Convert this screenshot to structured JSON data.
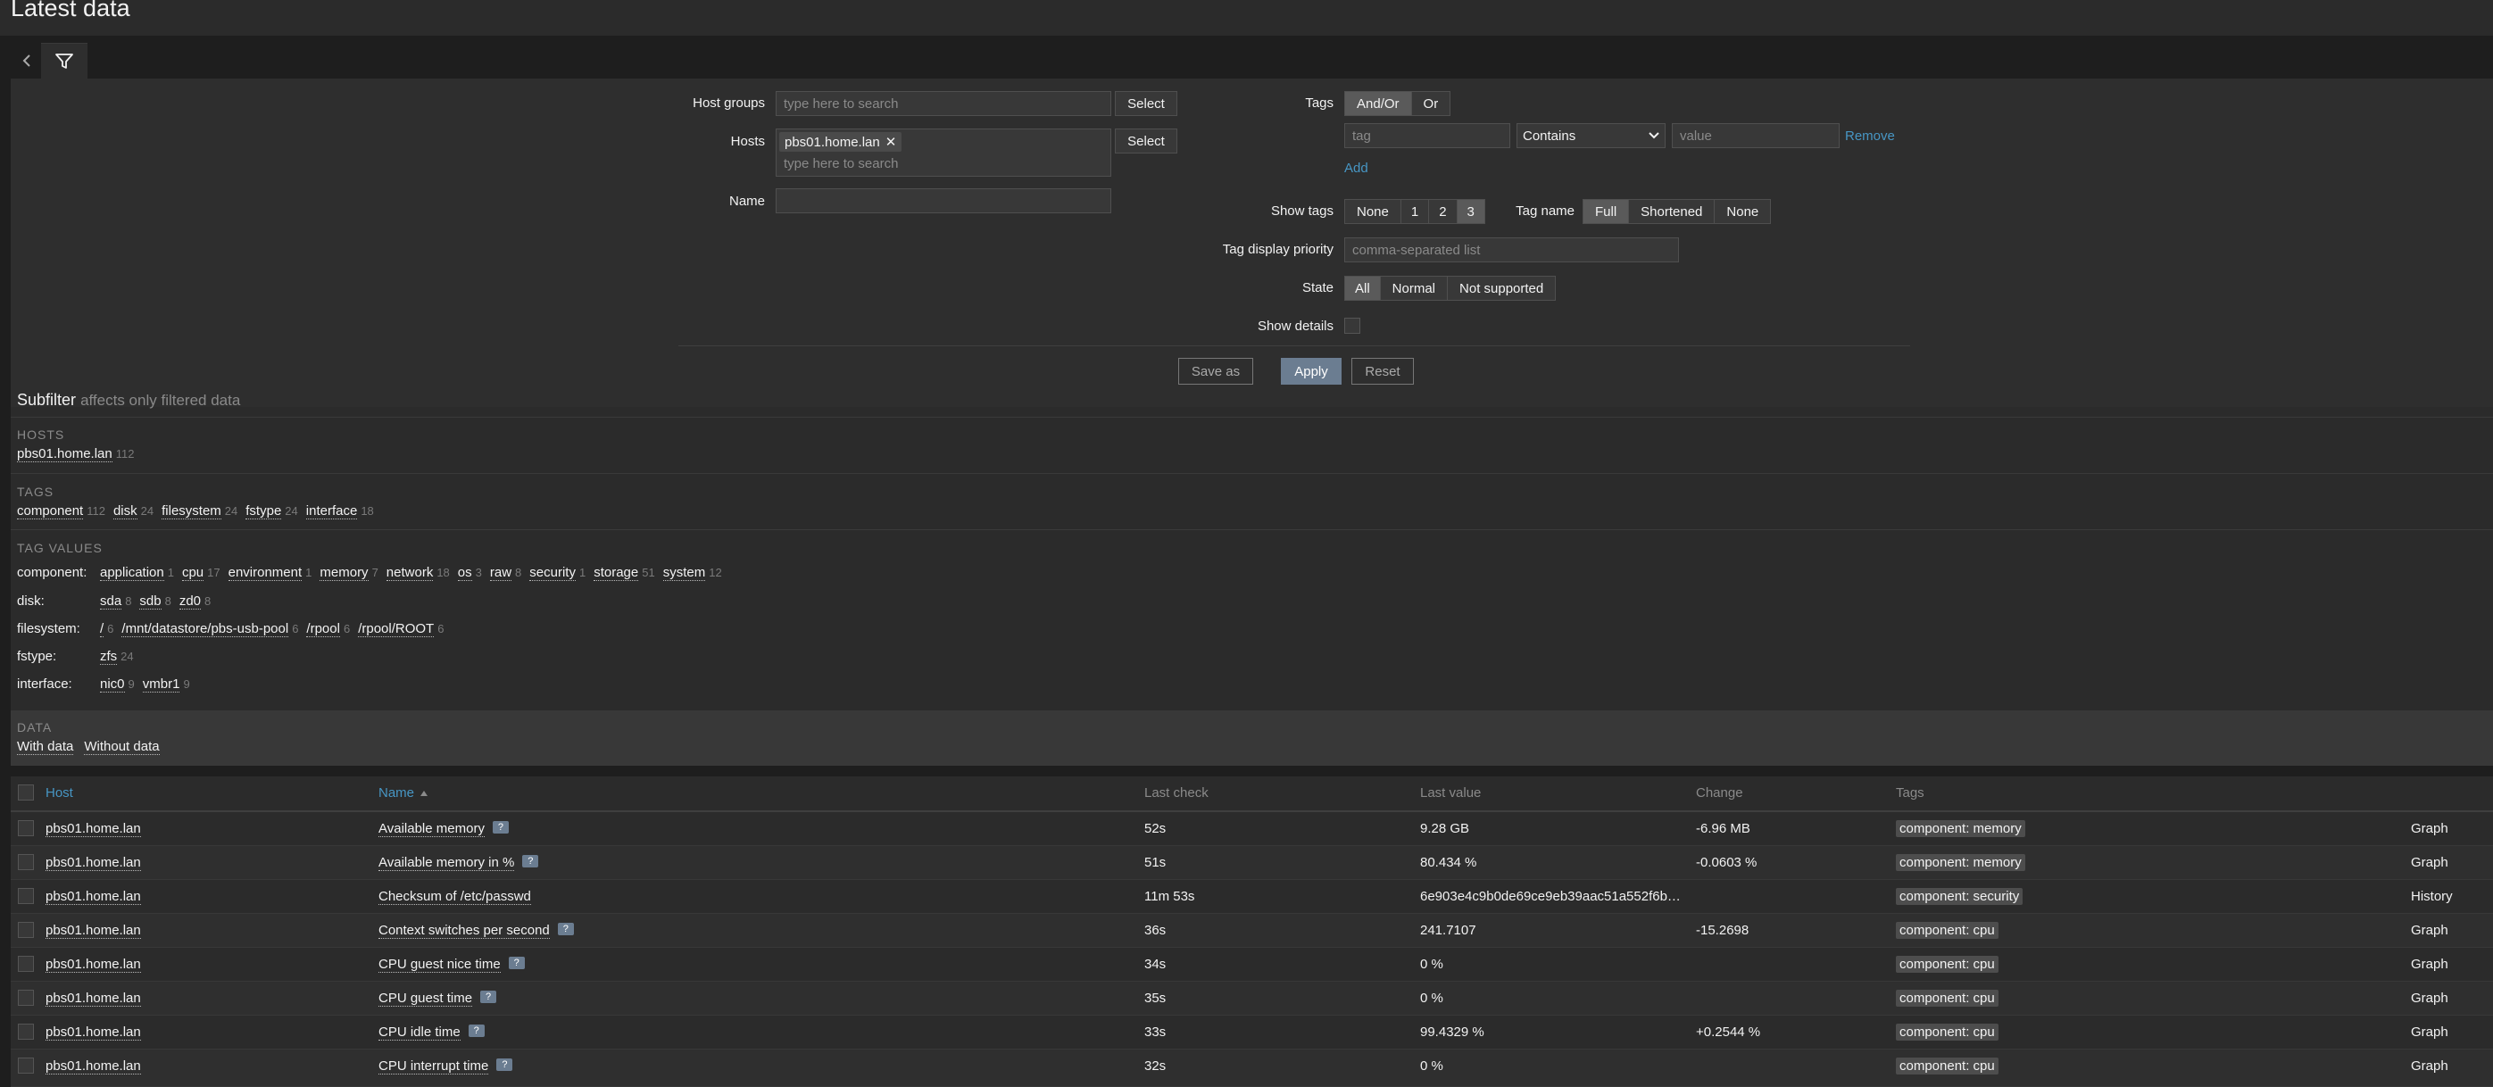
{
  "page_title": "Latest data",
  "icons": {
    "back": "chevron-left-icon",
    "filter": "filter-icon",
    "help": "help-icon",
    "remove": "close-icon",
    "sort": "sort-asc-icon"
  },
  "filter": {
    "host_groups_label": "Host groups",
    "host_groups_placeholder": "type here to search",
    "select_label": "Select",
    "hosts_label": "Hosts",
    "hosts_chip": "pbs01.home.lan",
    "hosts_placeholder": "type here to search",
    "name_label": "Name",
    "name_value": "",
    "tags_label": "Tags",
    "tags_mode": [
      "And/Or",
      "Or"
    ],
    "tag_placeholder": "tag",
    "tag_operator": "Contains",
    "value_placeholder": "value",
    "remove_label": "Remove",
    "add_label": "Add",
    "show_tags_label": "Show tags",
    "show_tags_options": [
      "None",
      "1",
      "2",
      "3"
    ],
    "tag_name_label": "Tag name",
    "tag_name_options": [
      "Full",
      "Shortened",
      "None"
    ],
    "tag_priority_label": "Tag display priority",
    "tag_priority_placeholder": "comma-separated list",
    "state_label": "State",
    "state_options": [
      "All",
      "Normal",
      "Not supported"
    ],
    "show_details_label": "Show details",
    "save_as_label": "Save as",
    "apply_label": "Apply",
    "reset_label": "Reset"
  },
  "subfilter": {
    "title": "Subfilter",
    "subtitle": "affects only filtered data",
    "hosts_heading": "HOSTS",
    "hosts": [
      {
        "name": "pbs01.home.lan",
        "count": "112"
      }
    ],
    "tags_heading": "TAGS",
    "tags": [
      {
        "name": "component",
        "count": "112"
      },
      {
        "name": "disk",
        "count": "24"
      },
      {
        "name": "filesystem",
        "count": "24"
      },
      {
        "name": "fstype",
        "count": "24"
      },
      {
        "name": "interface",
        "count": "18"
      }
    ],
    "tag_values_heading": "TAG VALUES",
    "tag_values": [
      {
        "label": "component:",
        "items": [
          {
            "name": "application",
            "count": "1"
          },
          {
            "name": "cpu",
            "count": "17"
          },
          {
            "name": "environment",
            "count": "1"
          },
          {
            "name": "memory",
            "count": "7"
          },
          {
            "name": "network",
            "count": "18"
          },
          {
            "name": "os",
            "count": "3"
          },
          {
            "name": "raw",
            "count": "8"
          },
          {
            "name": "security",
            "count": "1"
          },
          {
            "name": "storage",
            "count": "51"
          },
          {
            "name": "system",
            "count": "12"
          }
        ]
      },
      {
        "label": "disk:",
        "items": [
          {
            "name": "sda",
            "count": "8"
          },
          {
            "name": "sdb",
            "count": "8"
          },
          {
            "name": "zd0",
            "count": "8"
          }
        ]
      },
      {
        "label": "filesystem:",
        "items": [
          {
            "name": "/",
            "count": "6"
          },
          {
            "name": "/mnt/datastore/pbs-usb-pool",
            "count": "6"
          },
          {
            "name": "/rpool",
            "count": "6"
          },
          {
            "name": "/rpool/ROOT",
            "count": "6"
          }
        ]
      },
      {
        "label": "fstype:",
        "items": [
          {
            "name": "zfs",
            "count": "24"
          }
        ]
      },
      {
        "label": "interface:",
        "items": [
          {
            "name": "nic0",
            "count": "9"
          },
          {
            "name": "vmbr1",
            "count": "9"
          }
        ]
      }
    ],
    "data_heading": "DATA",
    "data_options": [
      "With data",
      "Without data"
    ]
  },
  "table": {
    "columns": [
      "Host",
      "Name",
      "Last check",
      "Last value",
      "Change",
      "Tags"
    ],
    "rows": [
      {
        "host": "pbs01.home.lan",
        "name": "Available memory",
        "help": true,
        "last_check": "52s",
        "last_value": "9.28 GB",
        "change": "-6.96 MB",
        "tag": "component: memory",
        "action": "Graph"
      },
      {
        "host": "pbs01.home.lan",
        "name": "Available memory in %",
        "help": true,
        "last_check": "51s",
        "last_value": "80.434 %",
        "change": "-0.0603 %",
        "tag": "component: memory",
        "action": "Graph"
      },
      {
        "host": "pbs01.home.lan",
        "name": "Checksum of /etc/passwd",
        "help": false,
        "last_check": "11m 53s",
        "last_value": "6e903e4c9b0de69ce9eb39aac51a552f6b…",
        "change": "",
        "tag": "component: security",
        "action": "History"
      },
      {
        "host": "pbs01.home.lan",
        "name": "Context switches per second",
        "help": true,
        "last_check": "36s",
        "last_value": "241.7107",
        "change": "-15.2698",
        "tag": "component: cpu",
        "action": "Graph"
      },
      {
        "host": "pbs01.home.lan",
        "name": "CPU guest nice time",
        "help": true,
        "last_check": "34s",
        "last_value": "0 %",
        "change": "",
        "tag": "component: cpu",
        "action": "Graph"
      },
      {
        "host": "pbs01.home.lan",
        "name": "CPU guest time",
        "help": true,
        "last_check": "35s",
        "last_value": "0 %",
        "change": "",
        "tag": "component: cpu",
        "action": "Graph"
      },
      {
        "host": "pbs01.home.lan",
        "name": "CPU idle time",
        "help": true,
        "last_check": "33s",
        "last_value": "99.4329 %",
        "change": "+0.2544 %",
        "tag": "component: cpu",
        "action": "Graph"
      },
      {
        "host": "pbs01.home.lan",
        "name": "CPU interrupt time",
        "help": true,
        "last_check": "32s",
        "last_value": "0 %",
        "change": "",
        "tag": "component: cpu",
        "action": "Graph"
      }
    ]
  }
}
